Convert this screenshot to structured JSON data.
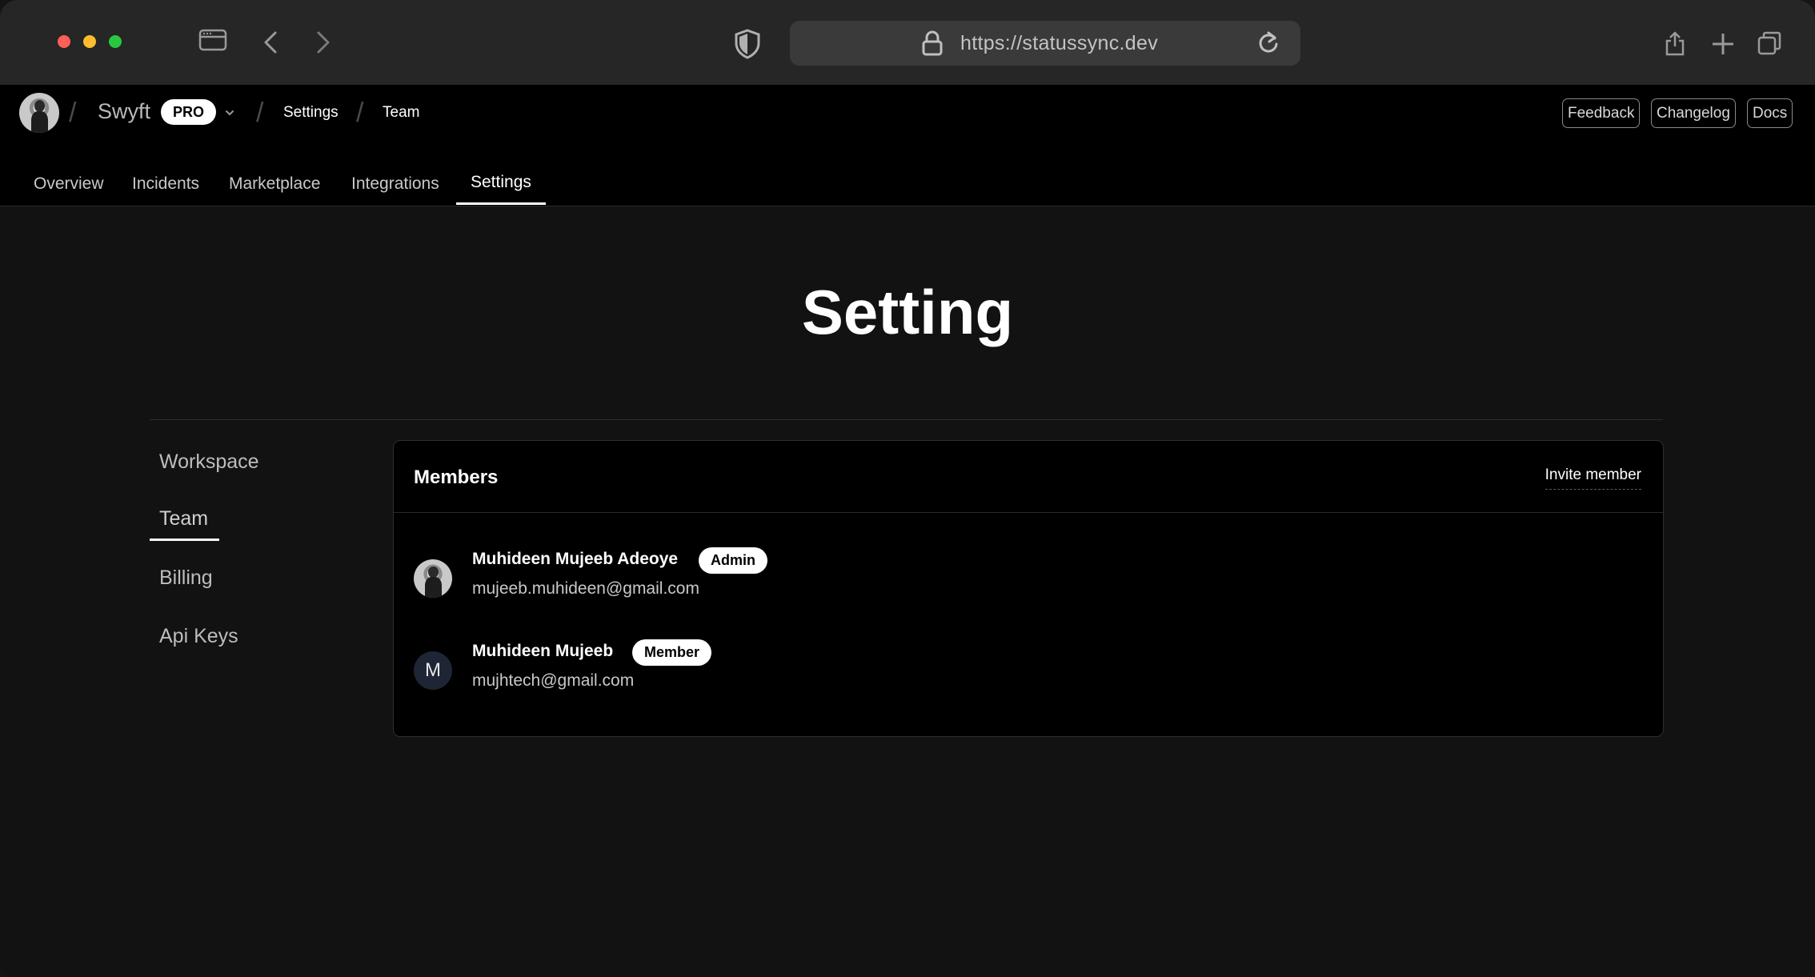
{
  "browser": {
    "url": "https://statussync.dev"
  },
  "header": {
    "brand": "Swyft",
    "plan_badge": "PRO",
    "breadcrumbs": [
      "Settings",
      "Team"
    ],
    "actions": [
      "Feedback",
      "Changelog",
      "Docs"
    ]
  },
  "tabs": [
    {
      "label": "Overview",
      "active": false
    },
    {
      "label": "Incidents",
      "active": false
    },
    {
      "label": "Marketplace",
      "active": false
    },
    {
      "label": "Integrations",
      "active": false
    },
    {
      "label": "Settings",
      "active": true
    }
  ],
  "page": {
    "title": "Setting"
  },
  "sidebar": {
    "items": [
      {
        "label": "Workspace",
        "active": false
      },
      {
        "label": "Team",
        "active": true
      },
      {
        "label": "Billing",
        "active": false
      },
      {
        "label": "Api Keys",
        "active": false
      }
    ]
  },
  "members_card": {
    "title": "Members",
    "invite_label": "Invite member",
    "members": [
      {
        "name": "Muhideen Mujeeb Adeoye",
        "role": "Admin",
        "email": "mujeeb.muhideen@gmail.com",
        "avatar": "photo"
      },
      {
        "name": "Muhideen Mujeeb",
        "role": "Member",
        "email": "mujhtech@gmail.com",
        "avatar": "M"
      }
    ]
  }
}
